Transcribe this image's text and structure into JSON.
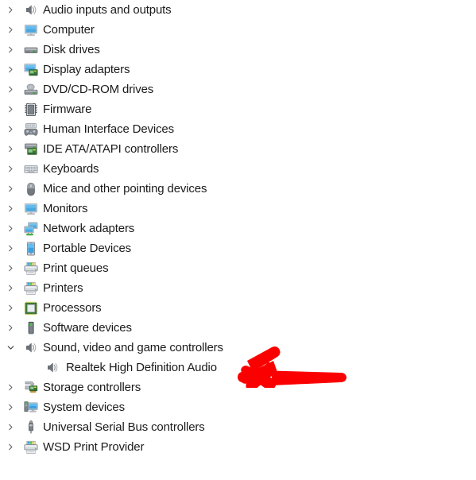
{
  "window": {
    "title": "Device Manager",
    "view": "device-tree"
  },
  "colors": {
    "text": "#1b1b1b",
    "background": "#ffffff",
    "chevron": "#3a3a3a",
    "annotation": "#fb0000",
    "icon_blue": "#3a9bdc",
    "icon_green": "#4ca64c",
    "icon_gray": "#6d7278"
  },
  "tree": {
    "items": [
      {
        "label": "Audio inputs and outputs",
        "icon": "speaker-icon",
        "level": 0,
        "expanded": false,
        "has_children": true
      },
      {
        "label": "Computer",
        "icon": "monitor-icon",
        "level": 0,
        "expanded": false,
        "has_children": true
      },
      {
        "label": "Disk drives",
        "icon": "disk-drive-icon",
        "level": 0,
        "expanded": false,
        "has_children": true
      },
      {
        "label": "Display adapters",
        "icon": "display-adapter-icon",
        "level": 0,
        "expanded": false,
        "has_children": true
      },
      {
        "label": "DVD/CD-ROM drives",
        "icon": "optical-drive-icon",
        "level": 0,
        "expanded": false,
        "has_children": true
      },
      {
        "label": "Firmware",
        "icon": "firmware-chip-icon",
        "level": 0,
        "expanded": false,
        "has_children": true
      },
      {
        "label": "Human Interface Devices",
        "icon": "hid-gamepad-icon",
        "level": 0,
        "expanded": false,
        "has_children": true
      },
      {
        "label": "IDE ATA/ATAPI controllers",
        "icon": "ide-controller-icon",
        "level": 0,
        "expanded": false,
        "has_children": true
      },
      {
        "label": "Keyboards",
        "icon": "keyboard-icon",
        "level": 0,
        "expanded": false,
        "has_children": true
      },
      {
        "label": "Mice and other pointing devices",
        "icon": "mouse-icon",
        "level": 0,
        "expanded": false,
        "has_children": true
      },
      {
        "label": "Monitors",
        "icon": "monitor-icon",
        "level": 0,
        "expanded": false,
        "has_children": true
      },
      {
        "label": "Network adapters",
        "icon": "network-adapter-icon",
        "level": 0,
        "expanded": false,
        "has_children": true
      },
      {
        "label": "Portable Devices",
        "icon": "portable-device-icon",
        "level": 0,
        "expanded": false,
        "has_children": true
      },
      {
        "label": "Print queues",
        "icon": "printer-icon",
        "level": 0,
        "expanded": false,
        "has_children": true
      },
      {
        "label": "Printers",
        "icon": "printer-icon",
        "level": 0,
        "expanded": false,
        "has_children": true
      },
      {
        "label": "Processors",
        "icon": "processor-icon",
        "level": 0,
        "expanded": false,
        "has_children": true
      },
      {
        "label": "Software devices",
        "icon": "software-device-icon",
        "level": 0,
        "expanded": false,
        "has_children": true
      },
      {
        "label": "Sound, video and game controllers",
        "icon": "speaker-icon",
        "level": 0,
        "expanded": true,
        "has_children": true
      },
      {
        "label": "Realtek High Definition Audio",
        "icon": "speaker-icon",
        "level": 1,
        "expanded": false,
        "has_children": false
      },
      {
        "label": "Storage controllers",
        "icon": "storage-controller-icon",
        "level": 0,
        "expanded": false,
        "has_children": true
      },
      {
        "label": "System devices",
        "icon": "system-device-icon",
        "level": 0,
        "expanded": false,
        "has_children": true
      },
      {
        "label": "Universal Serial Bus controllers",
        "icon": "usb-icon",
        "level": 0,
        "expanded": false,
        "has_children": true
      },
      {
        "label": "WSD Print Provider",
        "icon": "printer-icon",
        "level": 0,
        "expanded": false,
        "has_children": true
      }
    ]
  },
  "annotation": {
    "type": "arrow",
    "direction": "left",
    "color": "#fb0000",
    "points_to": "Sound, video and game controllers"
  }
}
